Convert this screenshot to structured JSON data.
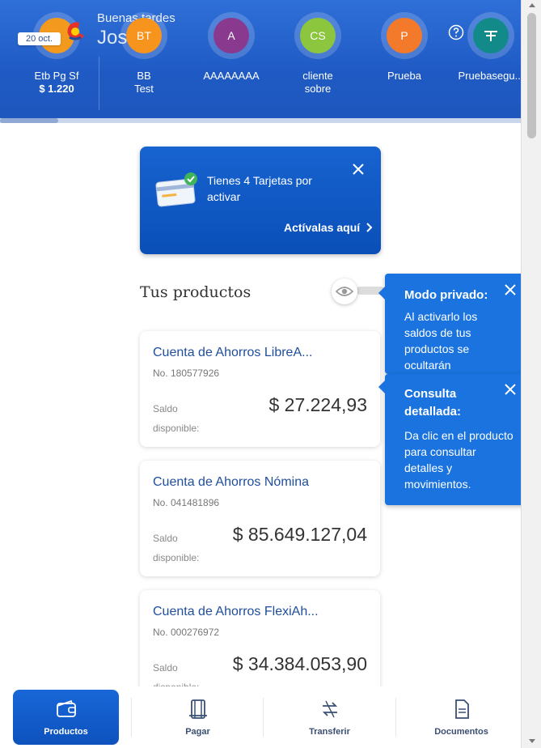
{
  "header": {
    "greeting": "Buenas tardes",
    "user_name": "Jose",
    "date_chip": "20 oct.",
    "contacts": [
      {
        "initials": "",
        "name": "Etb Pg Sf",
        "value": "$ 1.220",
        "color": "#f39a1e"
      },
      {
        "initials": "BT",
        "name": "BB",
        "name2": "Test",
        "color": "#f7941d"
      },
      {
        "initials": "A",
        "name": "AAAAAAAA",
        "color": "#8a3a8e"
      },
      {
        "initials": "CS",
        "name": "cliente",
        "name2": "sobre",
        "color": "#8cc63f"
      },
      {
        "initials": "P",
        "name": "Prueba",
        "color": "#f37a2a"
      },
      {
        "initials": "",
        "name": "Pruebasegu...",
        "color": "#138a8a"
      }
    ]
  },
  "banner": {
    "text": "Tienes 4 Tarjetas por activar",
    "link": "Actívalas aquí"
  },
  "section_title": "Tus productos",
  "products": [
    {
      "name": "Cuenta de Ahorros LibreA...",
      "number": "No. 180577926",
      "label": "Saldo disponible:",
      "amount": "$ 27.224,93"
    },
    {
      "name": "Cuenta de Ahorros Nómina",
      "number": "No. 041481896",
      "label": "Saldo disponible:",
      "amount": "$ 85.649.127,04"
    },
    {
      "name": "Cuenta de Ahorros FlexiAh...",
      "number": "No. 000276972",
      "label": "Saldo disponible:",
      "amount": "$ 34.384.053,90"
    }
  ],
  "tooltips": {
    "privacy": {
      "title": "Modo privado:",
      "body": "Al activarlo los saldos de tus productos se ocultarán"
    },
    "detail": {
      "title": "Consulta detallada:",
      "body": "Da clic en el producto para consultar detalles y movimientos."
    }
  },
  "nav": [
    {
      "label": "Productos",
      "icon": "wallet-icon",
      "active": true
    },
    {
      "label": "Pagar",
      "icon": "receipt-icon"
    },
    {
      "label": "Transferir",
      "icon": "transfer-icon"
    },
    {
      "label": "Documentos",
      "icon": "document-icon"
    }
  ],
  "colors": {
    "primary": "#1763d0",
    "tooltip": "#1a73de",
    "header": "#2f6fd8"
  }
}
